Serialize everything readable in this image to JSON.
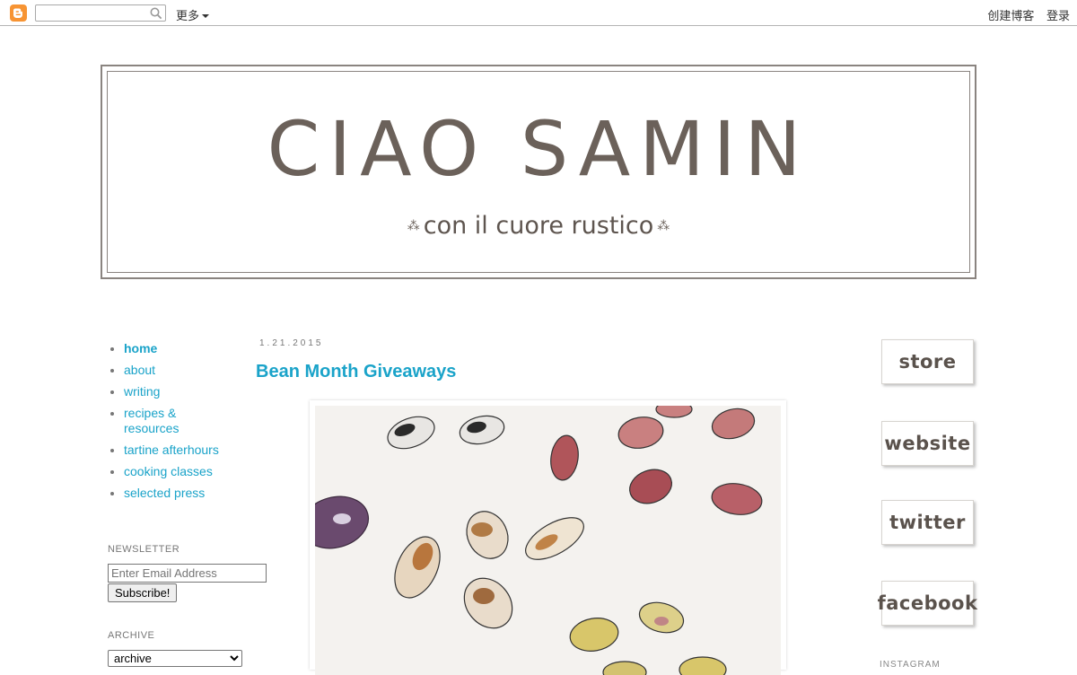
{
  "navbar": {
    "logo_icon": "blogger-logo-icon",
    "search_placeholder": "",
    "more_label": "更多",
    "create_blog_label": "创建博客",
    "login_label": "登录"
  },
  "header": {
    "title": "CIAO SAMIN",
    "tagline": "con il cuore rustico",
    "ornament": "⁂"
  },
  "sidebar": {
    "pages": [
      {
        "label": "home",
        "active": true
      },
      {
        "label": "about"
      },
      {
        "label": "writing"
      },
      {
        "label": "recipes & resources"
      },
      {
        "label": "tartine afterhours"
      },
      {
        "label": "cooking classes"
      },
      {
        "label": "selected press"
      }
    ],
    "newsletter": {
      "title": "NEWSLETTER",
      "email_placeholder": "Enter Email Address",
      "subscribe_label": "Subscribe!"
    },
    "archive": {
      "title": "ARCHIVE",
      "selected": "archive"
    }
  },
  "post": {
    "date": "1.21.2015",
    "title": "Bean Month Giveaways"
  },
  "right_sidebar": {
    "buttons": [
      {
        "label": "store"
      },
      {
        "label": "website"
      },
      {
        "label": "twitter"
      },
      {
        "label": "facebook"
      }
    ],
    "instagram_label": "INSTAGRAM"
  },
  "colors": {
    "link": "#1aa3c9",
    "header_text": "#6b615a",
    "blogger_orange": "#f79433"
  }
}
